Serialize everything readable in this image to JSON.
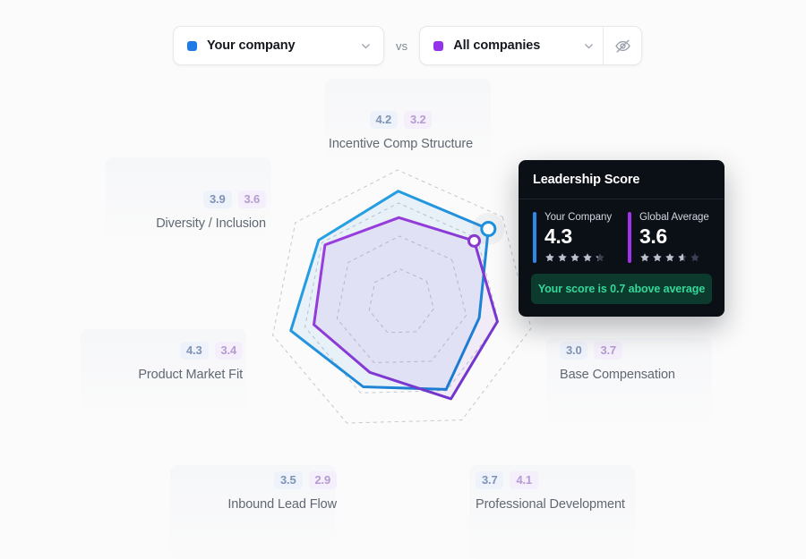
{
  "controls": {
    "your_company": {
      "label": "Your company",
      "swatch_color": "#1e7ae6",
      "chevron_icon": "chevron-down-icon"
    },
    "vs_label": "vs",
    "all_companies": {
      "label": "All companies",
      "swatch_color": "#9333ea",
      "chevron_icon": "chevron-down-icon"
    },
    "visibility_toggle_icon": "eye-off-icon"
  },
  "tooltip": {
    "title": "Leadership Score",
    "mine": {
      "label": "Your Company",
      "value": "4.3",
      "stars": 4.3,
      "accent": "#2b8ae8"
    },
    "global": {
      "label": "Global Average",
      "value": "3.6",
      "stars": 3.6,
      "accent": "#a033e8"
    },
    "delta_text": "Your score is 0.7 above average",
    "delta_color": "#34d79a",
    "delta_background": "#0c3a2c"
  },
  "chart_data": {
    "type": "radar",
    "title": "",
    "max": 5,
    "rings": 4,
    "grid": "dashed",
    "legend_position": "top",
    "categories": [
      "Leadership Score",
      "Base Compensation",
      "Professional Development",
      "Inbound Lead Flow",
      "Product Market Fit",
      "Diversity / Inclusion",
      "Incentive Comp Structure"
    ],
    "series": [
      {
        "name": "Your company",
        "color": "#1e90e0",
        "fill": "rgba(70,150,230,0.10)",
        "values": [
          4.3,
          3.0,
          3.7,
          3.5,
          4.3,
          3.9,
          4.2
        ]
      },
      {
        "name": "All companies",
        "color": "#8b38cf",
        "fill": "rgba(140,80,210,0.09)",
        "values": [
          3.6,
          3.7,
          4.1,
          2.9,
          3.4,
          3.6,
          3.2
        ]
      }
    ],
    "highlighted_category": "Leadership Score"
  },
  "axis_labels": [
    {
      "name": "Incentive Comp Structure",
      "mine": "4.2",
      "global": "3.2"
    },
    {
      "name": "Diversity / Inclusion",
      "mine": "3.9",
      "global": "3.6"
    },
    {
      "name": "Product Market Fit",
      "mine": "4.3",
      "global": "3.4"
    },
    {
      "name": "Inbound Lead Flow",
      "mine": "3.5",
      "global": "2.9"
    },
    {
      "name": "Professional Development",
      "mine": "3.7",
      "global": "4.1"
    },
    {
      "name": "Base Compensation",
      "mine": "3.0",
      "global": "3.7"
    }
  ]
}
